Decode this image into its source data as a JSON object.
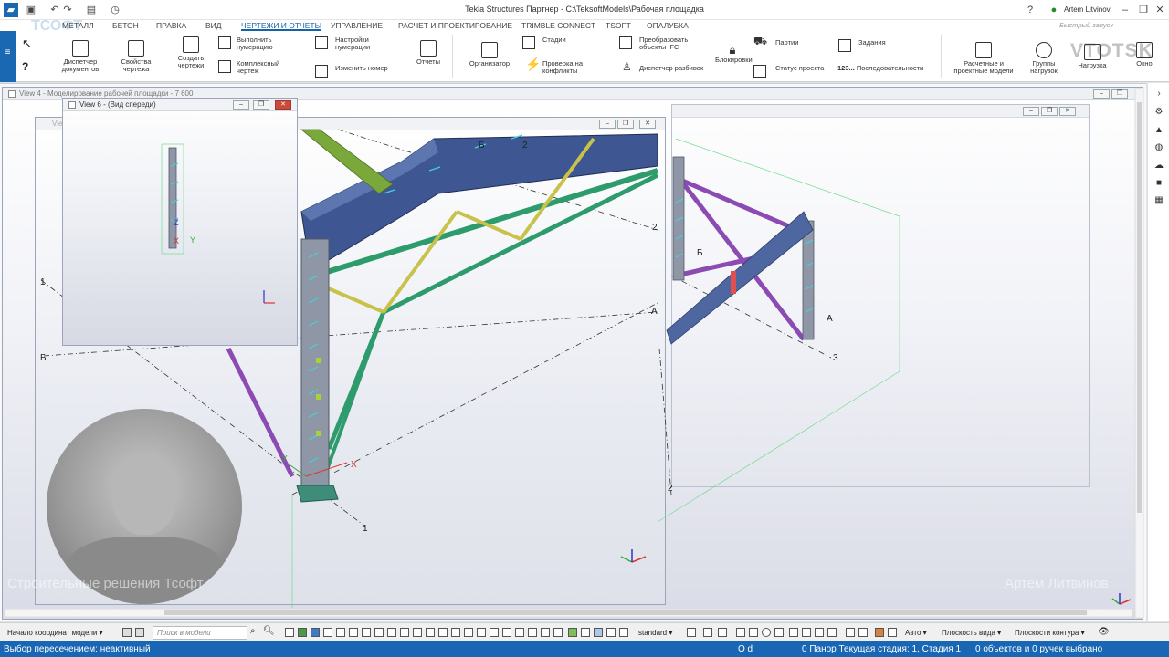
{
  "titlebar": {
    "title": "Tekla Structures Партнер - C:\\TeksoftModels\\Рабочая площадка",
    "user": "Artem Litvinov",
    "quick_search_placeholder": "Быстрый запуск"
  },
  "tabs": [
    "МЕТАЛЛ",
    "БЕТОН",
    "ПРАВКА",
    "ВИД",
    "ЧЕРТЕЖИ И ОТЧЕТЫ",
    "УПРАВЛЕНИЕ",
    "РАСЧЕТ И ПРОЕКТИРОВАНИЕ",
    "TRIMBLE CONNECT",
    "TSOFT",
    "ОПАЛУБКА"
  ],
  "active_tab": "ЧЕРТЕЖИ И ОТЧЕТЫ",
  "ribbon": {
    "doc_manager": "Диспетчер документов",
    "drawing_props": "Свойства чертежа",
    "create_drawings": "Создать чертежи",
    "run_numbering": "Выполнить нумерацию",
    "complex_drawing": "Комплексный чертеж",
    "numbering_settings": "Настройки нумерации",
    "change_number": "Изменить номер",
    "reports": "Отчеты",
    "organizer": "Организатор",
    "stages": "Стадии",
    "clash_check": "Проверка на конфликты",
    "convert_ifc": "Преобразовать объекты IFC",
    "layout_manager": "Диспетчер разбивок",
    "locks": "Блокировки",
    "lots": "Партии",
    "project_status": "Статус проекта",
    "tasks": "Задания",
    "sequences": "Последовательности",
    "analysis_models": "Расчетные и проектные модели",
    "load_groups": "Группы нагрузок",
    "load": "Нагрузка",
    "window": "Окно",
    "seq_prefix": "123..."
  },
  "views": {
    "view4_title": "View 4 - Моделирование рабочей площадки - 7 600",
    "view6_title": "View 6 - (Вид спереди)",
    "view5_title": "View"
  },
  "model_labels": {
    "grid_1": "1",
    "grid_2": "2",
    "grid_3": "3",
    "grid_A": "A",
    "grid_B": "Б",
    "axis_x": "X",
    "axis_y": "Y",
    "axis_z": "Z"
  },
  "watermarks": {
    "left": "Строительные решения Тсофт",
    "right": "Артем Литвинов",
    "brand_left": "ТСОФТ",
    "brand_right": "VTOTSK"
  },
  "bottombar": {
    "origin": "Начало координат модели",
    "search_placeholder": "Поиск в модели",
    "standard": "standard",
    "auto": "Авто",
    "view_plane": "Плоскость вида",
    "contour_plane": "Плоскости контура"
  },
  "statusbar": {
    "left": "Выбор пересечением: неактивный",
    "od": "O d",
    "stage": "0  Панор Текущая стадия: 1, Стадия 1",
    "selected": "0 объектов и 0 ручек выбрано"
  },
  "colors": {
    "accent": "#1866b4",
    "beam_blue": "#3e5792",
    "truss_green": "#2e9b6d",
    "brace_yellow": "#c8c24a",
    "brace_purple": "#8b4bb2",
    "column_gray": "#8f97a6",
    "anchor_cyan": "#3fd3e0"
  }
}
